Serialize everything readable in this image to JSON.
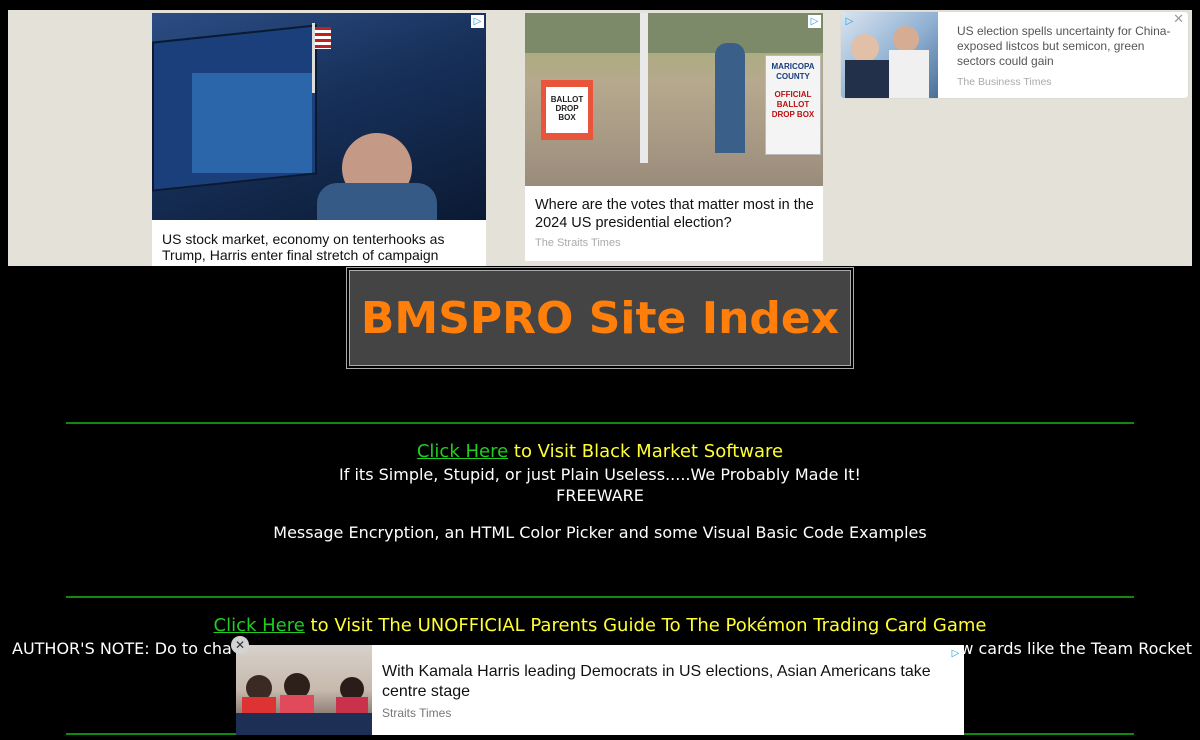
{
  "ads_top": [
    {
      "title": "US stock market, economy on tenterhooks as Trump, Harris enter final stretch of campaign",
      "source": ""
    },
    {
      "title": "Where are the votes that matter most in the 2024 US presidential election?",
      "source": "The Straits Times",
      "sign_left": "BALLOT DROP BOX",
      "sign_right_county": "MARICOPA COUNTY",
      "sign_right_box": "OFFICIAL BALLOT DROP BOX"
    },
    {
      "title": "US election spells uncertainty for China-exposed listcos but semicon, green sectors could gain",
      "source": "The Business Times"
    }
  ],
  "ad_choice_icon": "ad-choices-icon",
  "page_title": "BMSPRO Site Index",
  "section1": {
    "link_text": "Click Here",
    "link_rest": " to Visit Black Market Software",
    "tagline": "If its Simple, Stupid, or just Plain Useless.....We Probably Made It!",
    "label": "FREEWARE",
    "description": "Message Encryption, an HTML Color Picker and some Visual Basic Code Examples"
  },
  "section2": {
    "link_text": "Click Here",
    "link_rest": " to Visit The UNOFFICIAL Parents Guide To The Pokémon Trading Card Game",
    "author_note_left": "AUTHOR'S NOTE: Do to cha",
    "author_note_right": "ew cards like the Team Rocket"
  },
  "ad_bottom": {
    "title": "With Kamala Harris leading Democrats in US elections, Asian Americans take centre stage",
    "source": "Straits Times",
    "close_glyph": "✕"
  },
  "ad_close_glyph": "✕",
  "ad_choice_glyph": "▷",
  "colors": {
    "title": "#ff7f0a",
    "link": "#22cc22",
    "yellow": "#ffff33",
    "rule": "#0f8a0f"
  }
}
